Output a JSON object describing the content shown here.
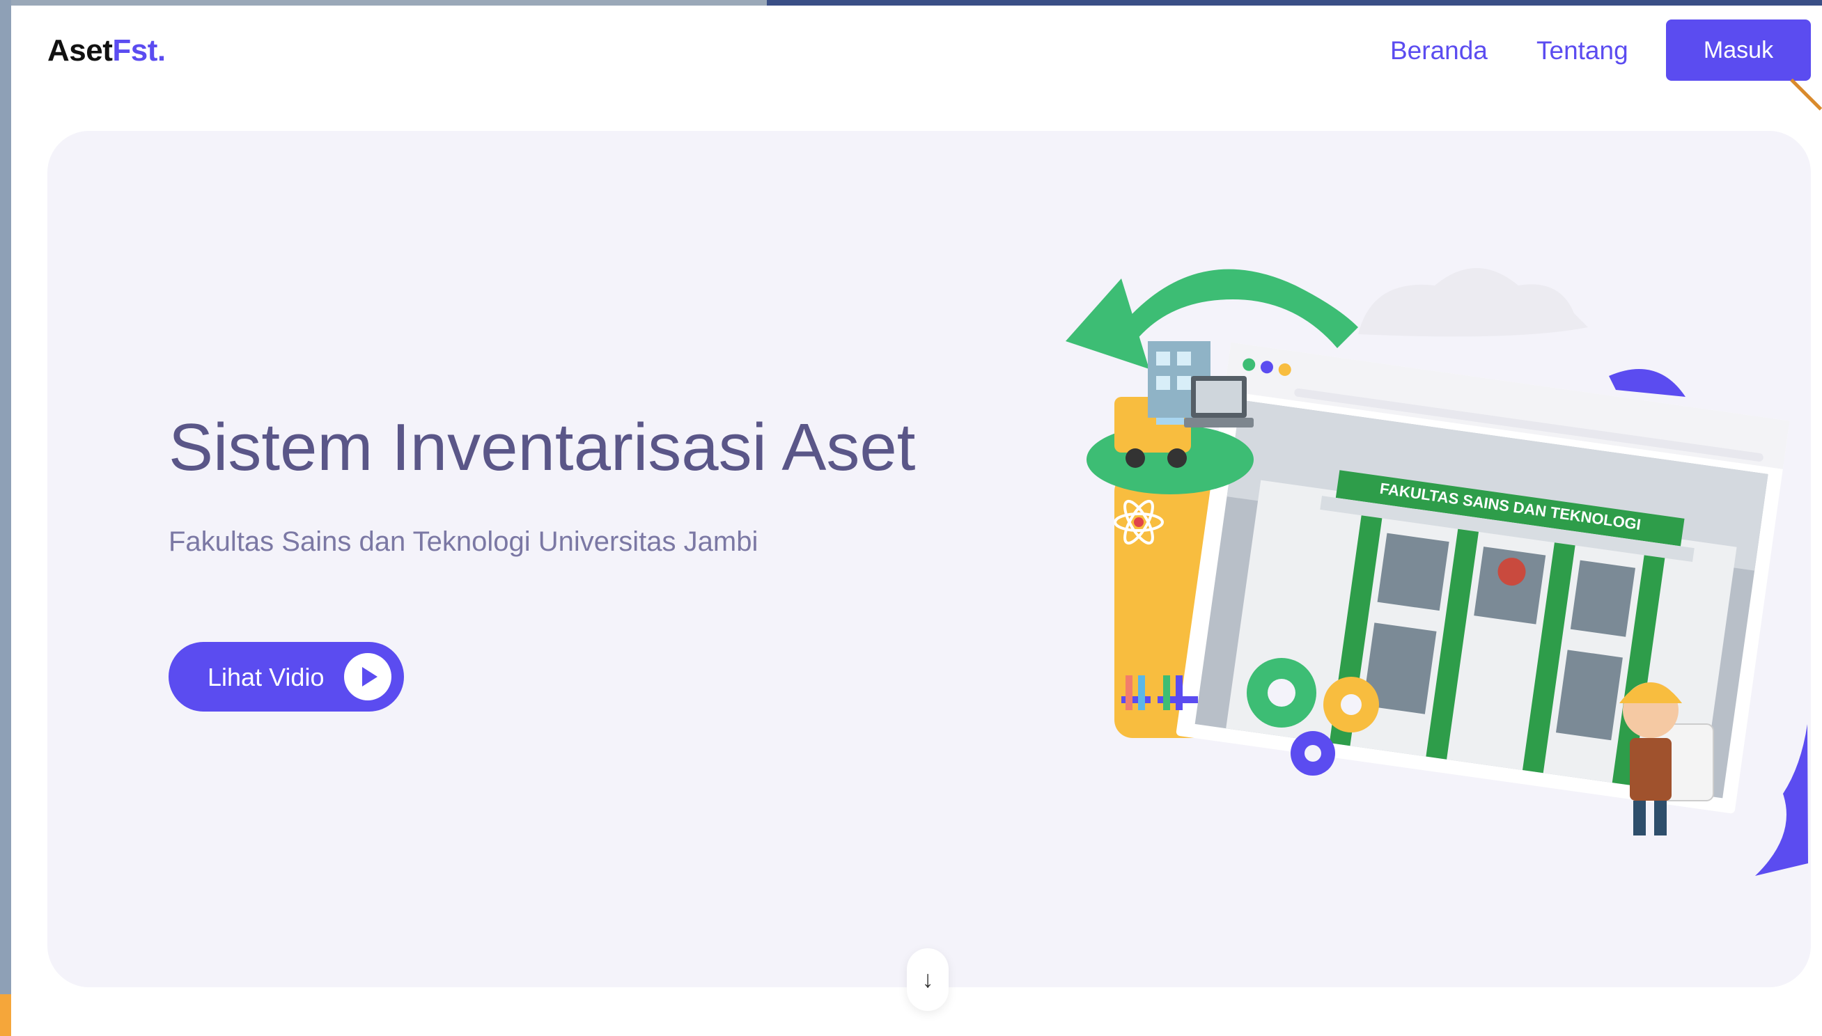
{
  "brand": {
    "part1": "Aset",
    "part2": "Fst."
  },
  "nav": {
    "beranda": "Beranda",
    "tentang": "Tentang",
    "masuk": "Masuk"
  },
  "hero": {
    "title": "Sistem Inventarisasi Aset",
    "subtitle": "Fakultas Sains dan Teknologi Universitas Jambi",
    "video_button": "Lihat Vidio",
    "building_sign": "FAKULTAS SAINS DAN TEKNOLOGI"
  },
  "scroll_icon": "↓",
  "colors": {
    "primary": "#5b4cf0",
    "hero_bg": "#f4f3fa",
    "title": "#5a5688",
    "subtitle": "#7b78a4",
    "green_arrow": "#3dbd74",
    "yellow": "#f8bd3f"
  },
  "icons": [
    "arrow-down-icon",
    "play-icon",
    "recycle-arrow-icon",
    "gear-icon",
    "atom-icon",
    "truck-icon",
    "laptop-icon",
    "building-icon"
  ]
}
